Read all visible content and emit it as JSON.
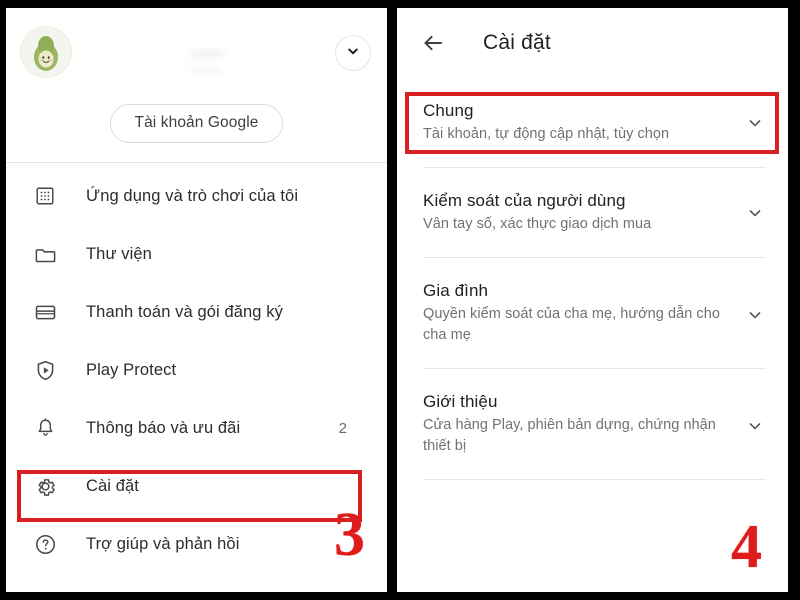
{
  "left_panel": {
    "account": {
      "avatar_icon": "avocado-avatar",
      "blurred_name_line1": "••••••",
      "blurred_name_line2": "•••••••",
      "expand_icon": "chevron-down-icon",
      "google_account_button": "Tài khoản Google"
    },
    "menu_items": [
      {
        "icon": "apps-grid-icon",
        "label": "Ứng dụng và trò chơi của tôi",
        "count": ""
      },
      {
        "icon": "folder-icon",
        "label": "Thư viện",
        "count": ""
      },
      {
        "icon": "credit-card-icon",
        "label": "Thanh toán và gói đăng ký",
        "count": ""
      },
      {
        "icon": "play-protect-icon",
        "label": "Play Protect",
        "count": ""
      },
      {
        "icon": "bell-icon",
        "label": "Thông báo và ưu đãi",
        "count": "2"
      },
      {
        "icon": "gear-icon",
        "label": "Cài đặt",
        "count": ""
      },
      {
        "icon": "help-circle-icon",
        "label": "Trợ giúp và phản hồi",
        "count": ""
      }
    ],
    "step_number": "3",
    "highlight_target": "Cài đặt"
  },
  "right_panel": {
    "topbar": {
      "back_icon": "arrow-left-icon",
      "title": "Cài đặt"
    },
    "sections": [
      {
        "title": "Chung",
        "subtitle": "Tài khoản, tự động cập nhật, tùy chọn",
        "chevron_icon": "chevron-down-icon",
        "highlighted": true
      },
      {
        "title": "Kiểm soát của người dùng",
        "subtitle": "Vân tay số, xác thực giao dịch mua",
        "chevron_icon": "chevron-down-icon",
        "highlighted": false
      },
      {
        "title": "Gia đình",
        "subtitle": "Quyền kiểm soát của cha mẹ, hướng dẫn cho cha mẹ",
        "chevron_icon": "chevron-down-icon",
        "highlighted": false
      },
      {
        "title": "Giới thiệu",
        "subtitle": "Cửa hàng Play, phiên bản dựng, chứng nhận thiết bị",
        "chevron_icon": "chevron-down-icon",
        "highlighted": false
      }
    ],
    "step_number": "4",
    "highlight_target": "Chung"
  },
  "colors": {
    "annotation_red": "#d82020",
    "step_red": "#e01b1b",
    "text_primary": "#202124",
    "text_secondary": "#6e7276",
    "divider": "#e6e6e6",
    "frame": "#000000"
  }
}
